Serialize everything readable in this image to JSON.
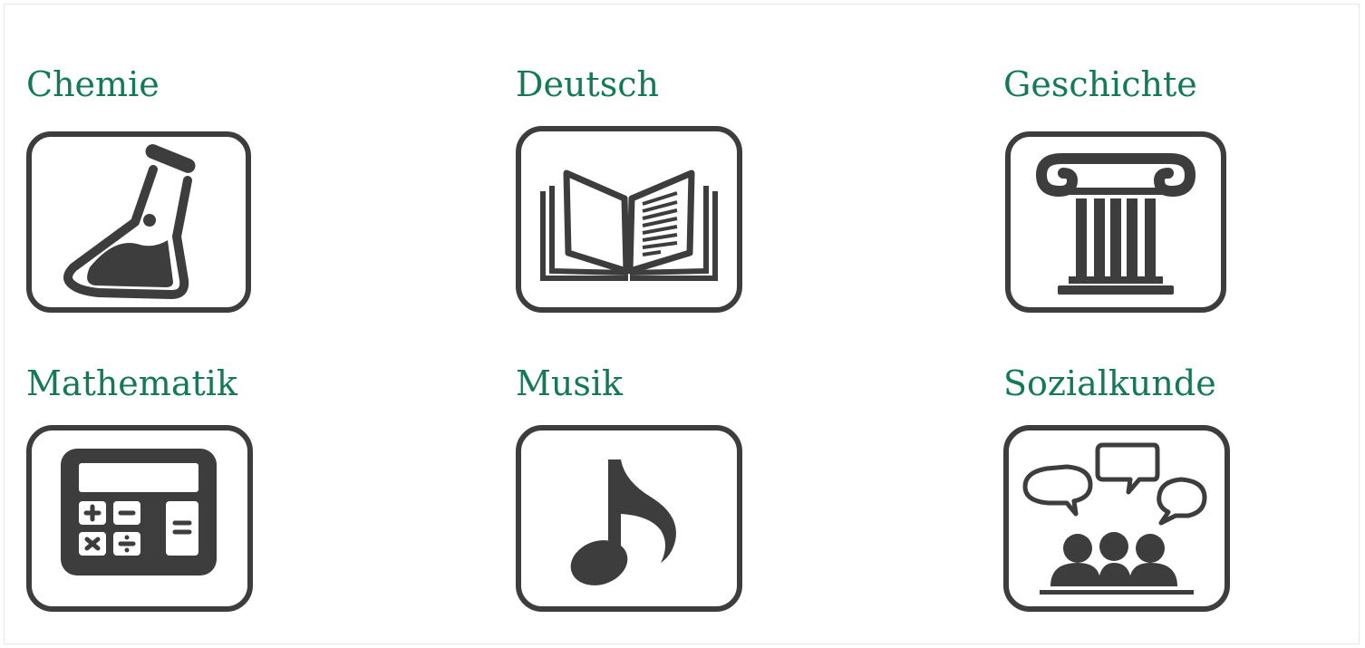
{
  "colors": {
    "title": "#137a55",
    "icon": "#3d3d3d",
    "background": "#ffffff"
  },
  "subjects": [
    {
      "label": "Chemie",
      "icon": "flask-icon"
    },
    {
      "label": "Deutsch",
      "icon": "open-book-icon"
    },
    {
      "label": "Geschichte",
      "icon": "column-icon"
    },
    {
      "label": "Mathematik",
      "icon": "calculator-icon"
    },
    {
      "label": "Musik",
      "icon": "music-note-icon"
    },
    {
      "label": "Sozialkunde",
      "icon": "discussion-group-icon"
    }
  ]
}
